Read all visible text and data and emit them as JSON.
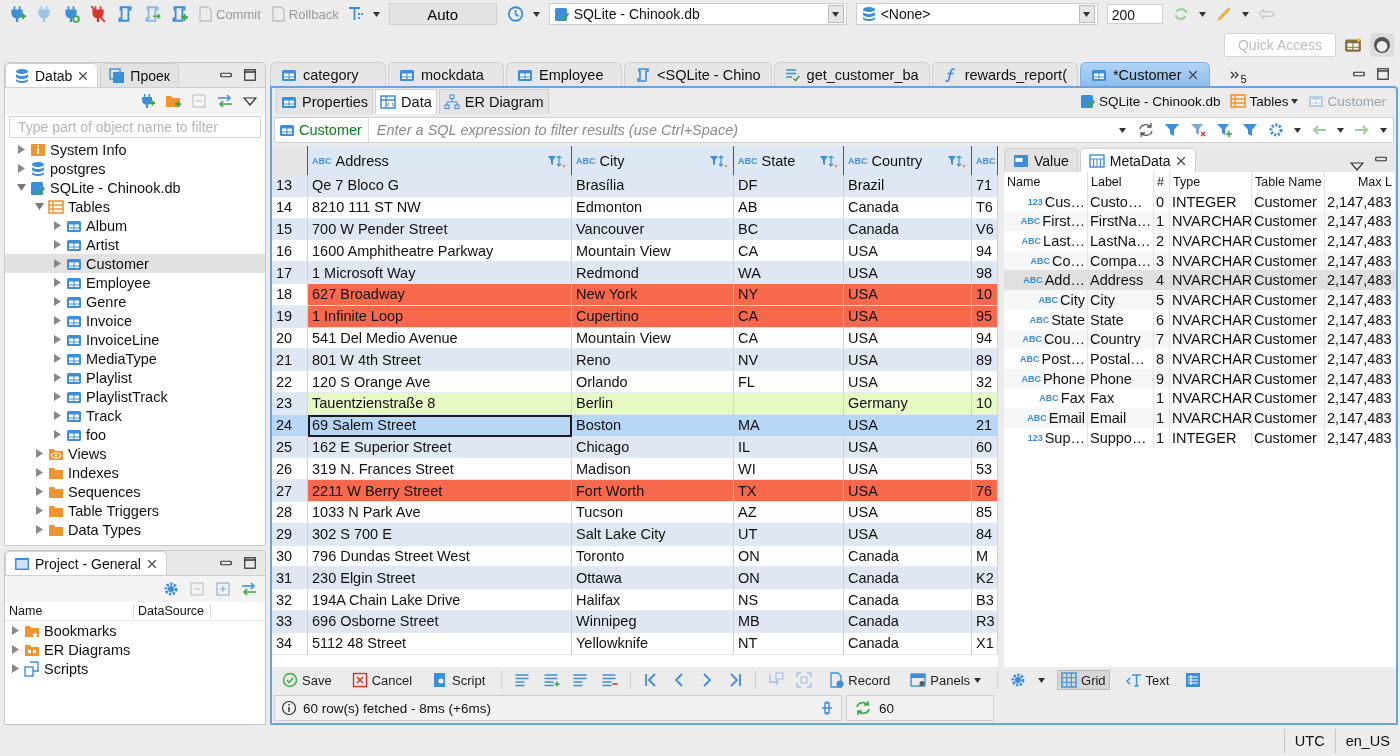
{
  "toolbar": {
    "buttons": [
      {
        "label": "Commit",
        "disabled": true
      },
      {
        "label": "Rollback",
        "disabled": true
      }
    ],
    "mode": "Auto",
    "datasource": "SQLite - Chinook.db",
    "schema": "<None>",
    "fetch_size": "200"
  },
  "quick_access": {
    "placeholder": "Quick Access"
  },
  "navigator": {
    "tabs": [
      {
        "label": "Datab",
        "selected": true
      },
      {
        "label": "Проек",
        "selected": false
      }
    ],
    "filter": {
      "placeholder": "Type part of object name to filter"
    },
    "tree": [
      {
        "label": "System Info",
        "kind": "info",
        "expanded": false,
        "selected": false
      },
      {
        "label": "postgres",
        "kind": "database",
        "expanded": false,
        "selected": false
      },
      {
        "label": "SQLite - Chinook.db",
        "kind": "sqlite",
        "expanded": true,
        "selected": false,
        "children": [
          {
            "label": "Tables",
            "kind": "tables",
            "expanded": true,
            "selected": false,
            "children": [
              {
                "label": "Album",
                "kind": "table",
                "expanded": false,
                "selected": false
              },
              {
                "label": "Artist",
                "kind": "table",
                "expanded": false,
                "selected": false
              },
              {
                "label": "Customer",
                "kind": "table",
                "expanded": false,
                "selected": true
              },
              {
                "label": "Employee",
                "kind": "table",
                "expanded": false,
                "selected": false
              },
              {
                "label": "Genre",
                "kind": "table",
                "expanded": false,
                "selected": false
              },
              {
                "label": "Invoice",
                "kind": "table",
                "expanded": false,
                "selected": false
              },
              {
                "label": "InvoiceLine",
                "kind": "table",
                "expanded": false,
                "selected": false
              },
              {
                "label": "MediaType",
                "kind": "table",
                "expanded": false,
                "selected": false
              },
              {
                "label": "Playlist",
                "kind": "table",
                "expanded": false,
                "selected": false
              },
              {
                "label": "PlaylistTrack",
                "kind": "table",
                "expanded": false,
                "selected": false
              },
              {
                "label": "Track",
                "kind": "table",
                "expanded": false,
                "selected": false
              },
              {
                "label": "foo",
                "kind": "table",
                "expanded": false,
                "selected": false
              }
            ]
          },
          {
            "label": "Views",
            "kind": "views",
            "expanded": false,
            "selected": false
          },
          {
            "label": "Indexes",
            "kind": "folder",
            "expanded": false,
            "selected": false
          },
          {
            "label": "Sequences",
            "kind": "folder",
            "expanded": false,
            "selected": false
          },
          {
            "label": "Table Triggers",
            "kind": "folder",
            "expanded": false,
            "selected": false
          },
          {
            "label": "Data Types",
            "kind": "folder",
            "expanded": false,
            "selected": false
          }
        ]
      }
    ]
  },
  "project": {
    "title": "Project - General",
    "columns": [
      "Name",
      "DataSource"
    ],
    "items": [
      {
        "label": "Bookmarks",
        "kind": "bookmarks"
      },
      {
        "label": "ER Diagrams",
        "kind": "diagrams"
      },
      {
        "label": "Scripts",
        "kind": "scripts"
      }
    ]
  },
  "editor_tabs": [
    {
      "label": "category",
      "kind": "table",
      "selected": false
    },
    {
      "label": "mockdata",
      "kind": "table",
      "selected": false
    },
    {
      "label": "Employee",
      "kind": "table",
      "selected": false
    },
    {
      "label": "<SQLite - Chino",
      "kind": "script",
      "selected": false
    },
    {
      "label": "get_customer_ba",
      "kind": "procedure",
      "selected": false
    },
    {
      "label": "rewards_report(",
      "kind": "function",
      "selected": false
    },
    {
      "label": "*Customer",
      "kind": "table",
      "selected": true
    }
  ],
  "hidden_tabs": "5",
  "subtabs": [
    {
      "label": "Properties",
      "kind": "properties",
      "selected": false
    },
    {
      "label": "Data",
      "kind": "data",
      "selected": true
    },
    {
      "label": "ER Diagram",
      "kind": "diagram",
      "selected": false
    }
  ],
  "breadcrumb": [
    {
      "label": "SQLite - Chinook.db",
      "kind": "sqlite",
      "disabled": false
    },
    {
      "label": "Tables",
      "kind": "tables",
      "disabled": false
    },
    {
      "label": "Customer",
      "kind": "table",
      "disabled": true
    }
  ],
  "filter": {
    "entity": "Customer",
    "placeholder": "Enter a SQL expression to filter results (use Ctrl+Space)"
  },
  "grid": {
    "columns": [
      {
        "type": "ABC",
        "label": "Address"
      },
      {
        "type": "ABC",
        "label": "City"
      },
      {
        "type": "ABC",
        "label": "State"
      },
      {
        "type": "ABC",
        "label": "Country"
      },
      {
        "type": "ABC"
      }
    ],
    "rows": [
      {
        "num": "13",
        "cells": [
          "Qe 7 Bloco G",
          "Brasília",
          "DF",
          "Brazil",
          "71"
        ],
        "selected": false
      },
      {
        "num": "14",
        "cells": [
          "8210 111 ST NW",
          "Edmonton",
          "AB",
          "Canada",
          "T6"
        ],
        "selected": false
      },
      {
        "num": "15",
        "cells": [
          "700 W Pender Street",
          "Vancouver",
          "BC",
          "Canada",
          "V6"
        ],
        "selected": false
      },
      {
        "num": "16",
        "cells": [
          "1600 Amphitheatre Parkway",
          "Mountain View",
          "CA",
          "USA",
          "94"
        ],
        "selected": false
      },
      {
        "num": "17",
        "cells": [
          "1 Microsoft Way",
          "Redmond",
          "WA",
          "USA",
          "98"
        ],
        "selected": false
      },
      {
        "num": "18",
        "cells": [
          "627 Broadway",
          "New York",
          "NY",
          "USA",
          "10"
        ],
        "selected": false,
        "color": "#f7684c"
      },
      {
        "num": "19",
        "cells": [
          "1 Infinite Loop",
          "Cupertino",
          "CA",
          "USA",
          "95"
        ],
        "selected": false,
        "color": "#f7684c"
      },
      {
        "num": "20",
        "cells": [
          "541 Del Medio Avenue",
          "Mountain View",
          "CA",
          "USA",
          "94"
        ],
        "selected": false
      },
      {
        "num": "21",
        "cells": [
          "801 W 4th Street",
          "Reno",
          "NV",
          "USA",
          "89"
        ],
        "selected": false
      },
      {
        "num": "22",
        "cells": [
          "120 S Orange Ave",
          "Orlando",
          "FL",
          "USA",
          "32"
        ],
        "selected": false
      },
      {
        "num": "23",
        "cells": [
          "Tauentzienstraße 8",
          "Berlin",
          null,
          "Germany",
          "10"
        ],
        "selected": false,
        "color": "#e6f8c4"
      },
      {
        "num": "24",
        "cells": [
          "69 Salem Street",
          "Boston",
          "MA",
          "USA",
          "21"
        ],
        "selected": true
      },
      {
        "num": "25",
        "cells": [
          "162 E Superior Street",
          "Chicago",
          "IL",
          "USA",
          "60"
        ],
        "selected": false
      },
      {
        "num": "26",
        "cells": [
          "319 N. Frances Street",
          "Madison",
          "WI",
          "USA",
          "53"
        ],
        "selected": false
      },
      {
        "num": "27",
        "cells": [
          "2211 W Berry Street",
          "Fort Worth",
          "TX",
          "USA",
          "76"
        ],
        "selected": false,
        "color": "#f7684c"
      },
      {
        "num": "28",
        "cells": [
          "1033 N Park Ave",
          "Tucson",
          "AZ",
          "USA",
          "85"
        ],
        "selected": false
      },
      {
        "num": "29",
        "cells": [
          "302 S 700 E",
          "Salt Lake City",
          "UT",
          "USA",
          "84"
        ],
        "selected": false
      },
      {
        "num": "30",
        "cells": [
          "796 Dundas Street West",
          "Toronto",
          "ON",
          "Canada",
          "M"
        ],
        "selected": false
      },
      {
        "num": "31",
        "cells": [
          "230 Elgin Street",
          "Ottawa",
          "ON",
          "Canada",
          "K2"
        ],
        "selected": false
      },
      {
        "num": "32",
        "cells": [
          "194A Chain Lake Drive",
          "Halifax",
          "NS",
          "Canada",
          "B3"
        ],
        "selected": false
      },
      {
        "num": "33",
        "cells": [
          "696 Osborne Street",
          "Winnipeg",
          "MB",
          "Canada",
          "R3"
        ],
        "selected": false
      },
      {
        "num": "34",
        "cells": [
          "5112 48 Street",
          "Yellowknife",
          "NT",
          "Canada",
          "X1"
        ],
        "selected": false
      }
    ]
  },
  "side_panel": {
    "tabs": [
      {
        "label": "Value",
        "kind": "value",
        "selected": false
      },
      {
        "label": "MetaData",
        "kind": "metadata",
        "selected": true
      }
    ],
    "columns": [
      "Name",
      "Label",
      "#",
      "Type",
      "Table Name",
      "Max L"
    ],
    "rows": [
      {
        "type_badge": "123",
        "name": "Cus…",
        "label": "Custo…",
        "index": "0",
        "type": "INTEGER",
        "table": "Customer",
        "max": "2,147,483",
        "selected": false
      },
      {
        "type_badge": "ABC",
        "name": "First…",
        "label": "FirstNa…",
        "index": "1",
        "type": "NVARCHAR",
        "table": "Customer",
        "max": "2,147,483",
        "selected": false
      },
      {
        "type_badge": "ABC",
        "name": "Last…",
        "label": "LastNa…",
        "index": "2",
        "type": "NVARCHAR",
        "table": "Customer",
        "max": "2,147,483",
        "selected": false
      },
      {
        "type_badge": "ABC",
        "name": "Co…",
        "label": "Compa…",
        "index": "3",
        "type": "NVARCHAR",
        "table": "Customer",
        "max": "2,147,483",
        "selected": false
      },
      {
        "type_badge": "ABC",
        "name": "Add…",
        "label": "Address",
        "index": "4",
        "type": "NVARCHAR",
        "table": "Customer",
        "max": "2,147,483",
        "selected": true
      },
      {
        "type_badge": "ABC",
        "name": "City",
        "label": "City",
        "index": "5",
        "type": "NVARCHAR",
        "table": "Customer",
        "max": "2,147,483",
        "selected": false
      },
      {
        "type_badge": "ABC",
        "name": "State",
        "label": "State",
        "index": "6",
        "type": "NVARCHAR",
        "table": "Customer",
        "max": "2,147,483",
        "selected": false
      },
      {
        "type_badge": "ABC",
        "name": "Cou…",
        "label": "Country",
        "index": "7",
        "type": "NVARCHAR",
        "table": "Customer",
        "max": "2,147,483",
        "selected": false
      },
      {
        "type_badge": "ABC",
        "name": "Post…",
        "label": "Postal…",
        "index": "8",
        "type": "NVARCHAR",
        "table": "Customer",
        "max": "2,147,483",
        "selected": false
      },
      {
        "type_badge": "ABC",
        "name": "Phone",
        "label": "Phone",
        "index": "9",
        "type": "NVARCHAR",
        "table": "Customer",
        "max": "2,147,483",
        "selected": false
      },
      {
        "type_badge": "ABC",
        "name": "Fax",
        "label": "Fax",
        "index": "1",
        "type": "NVARCHAR",
        "table": "Customer",
        "max": "2,147,483",
        "selected": false
      },
      {
        "type_badge": "ABC",
        "name": "Email",
        "label": "Email",
        "index": "1",
        "type": "NVARCHAR",
        "table": "Customer",
        "max": "2,147,483",
        "selected": false
      },
      {
        "type_badge": "123",
        "name": "Sup…",
        "label": "Suppo…",
        "index": "1",
        "type": "INTEGER",
        "table": "Customer",
        "max": "2,147,483",
        "selected": false
      }
    ]
  },
  "result_toolbar": {
    "actions": [
      {
        "label": "Save",
        "kind": "save"
      },
      {
        "label": "Cancel",
        "kind": "cancel"
      },
      {
        "label": "Script",
        "kind": "script"
      }
    ],
    "record": "Record",
    "panels": "Panels",
    "views": [
      {
        "label": "Grid",
        "kind": "grid",
        "selected": true
      },
      {
        "label": "Text",
        "kind": "text",
        "selected": false
      }
    ]
  },
  "result_status": {
    "message": "60 row(s) fetched - 8ms (+6ms)",
    "count": "60"
  },
  "status_bar": [
    "UTC",
    "en_US"
  ]
}
